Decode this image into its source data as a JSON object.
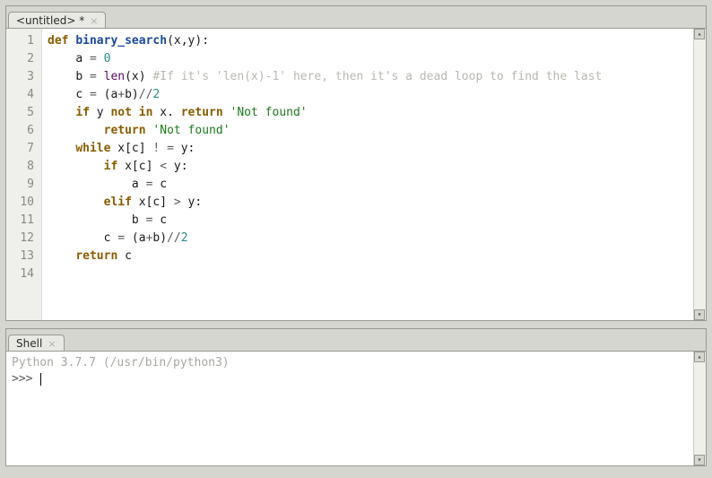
{
  "editor": {
    "tab_title": "<untitled> *",
    "line_numbers": [
      "1",
      "2",
      "3",
      "4",
      "5",
      "6",
      "7",
      "8",
      "9",
      "10",
      "11",
      "12",
      "13",
      "14"
    ],
    "code_lines": [
      {
        "indent": 0,
        "tokens": [
          {
            "t": "def ",
            "c": "kw"
          },
          {
            "t": "binary_search",
            "c": "fn"
          },
          {
            "t": "(x,y):",
            "c": ""
          }
        ]
      },
      {
        "indent": 1,
        "tokens": [
          {
            "t": "a ",
            "c": ""
          },
          {
            "t": "=",
            "c": "op"
          },
          {
            "t": " ",
            "c": ""
          },
          {
            "t": "0",
            "c": "num"
          }
        ]
      },
      {
        "indent": 1,
        "tokens": [
          {
            "t": "b ",
            "c": ""
          },
          {
            "t": "=",
            "c": "op"
          },
          {
            "t": " ",
            "c": ""
          },
          {
            "t": "len",
            "c": "builtin"
          },
          {
            "t": "(x) ",
            "c": ""
          },
          {
            "t": "#If it's 'len(x)-1' here, then it's a dead loop to find the last",
            "c": "cm"
          }
        ]
      },
      {
        "indent": 1,
        "tokens": [
          {
            "t": "c ",
            "c": ""
          },
          {
            "t": "=",
            "c": "op"
          },
          {
            "t": " (a",
            "c": ""
          },
          {
            "t": "+",
            "c": "op"
          },
          {
            "t": "b)",
            "c": ""
          },
          {
            "t": "//",
            "c": "op"
          },
          {
            "t": "2",
            "c": "num"
          }
        ]
      },
      {
        "indent": 1,
        "tokens": [
          {
            "t": "if",
            "c": "kw"
          },
          {
            "t": " y ",
            "c": ""
          },
          {
            "t": "not in",
            "c": "kw"
          },
          {
            "t": " x. ",
            "c": ""
          },
          {
            "t": "return",
            "c": "kw"
          },
          {
            "t": " ",
            "c": ""
          },
          {
            "t": "'Not found'",
            "c": "str"
          }
        ]
      },
      {
        "indent": 2,
        "tokens": [
          {
            "t": "return",
            "c": "kw"
          },
          {
            "t": " ",
            "c": ""
          },
          {
            "t": "'Not found'",
            "c": "str"
          }
        ]
      },
      {
        "indent": 1,
        "tokens": [
          {
            "t": "while",
            "c": "kw"
          },
          {
            "t": " x[c] ",
            "c": ""
          },
          {
            "t": "!",
            "c": "op"
          },
          {
            "t": " ",
            "c": ""
          },
          {
            "t": "=",
            "c": "op"
          },
          {
            "t": " y:",
            "c": ""
          }
        ]
      },
      {
        "indent": 2,
        "tokens": [
          {
            "t": "if",
            "c": "kw"
          },
          {
            "t": " x[c] ",
            "c": ""
          },
          {
            "t": "<",
            "c": "op"
          },
          {
            "t": " y:",
            "c": ""
          }
        ]
      },
      {
        "indent": 3,
        "tokens": [
          {
            "t": "a ",
            "c": ""
          },
          {
            "t": "=",
            "c": "op"
          },
          {
            "t": " c",
            "c": ""
          }
        ]
      },
      {
        "indent": 2,
        "tokens": [
          {
            "t": "elif",
            "c": "kw"
          },
          {
            "t": " x[c] ",
            "c": ""
          },
          {
            "t": ">",
            "c": "op"
          },
          {
            "t": " y:",
            "c": ""
          }
        ]
      },
      {
        "indent": 3,
        "tokens": [
          {
            "t": "b ",
            "c": ""
          },
          {
            "t": "=",
            "c": "op"
          },
          {
            "t": " c",
            "c": ""
          }
        ]
      },
      {
        "indent": 2,
        "tokens": [
          {
            "t": "c ",
            "c": ""
          },
          {
            "t": "=",
            "c": "op"
          },
          {
            "t": " (a",
            "c": ""
          },
          {
            "t": "+",
            "c": "op"
          },
          {
            "t": "b)",
            "c": ""
          },
          {
            "t": "//",
            "c": "op"
          },
          {
            "t": "2",
            "c": "num"
          }
        ]
      },
      {
        "indent": 1,
        "tokens": [
          {
            "t": "return",
            "c": "kw"
          },
          {
            "t": " c",
            "c": ""
          }
        ]
      },
      {
        "indent": 0,
        "tokens": []
      }
    ]
  },
  "shell": {
    "tab_title": "Shell",
    "version_line": "Python 3.7.7 (/usr/bin/python3)",
    "prompt": ">>> "
  }
}
